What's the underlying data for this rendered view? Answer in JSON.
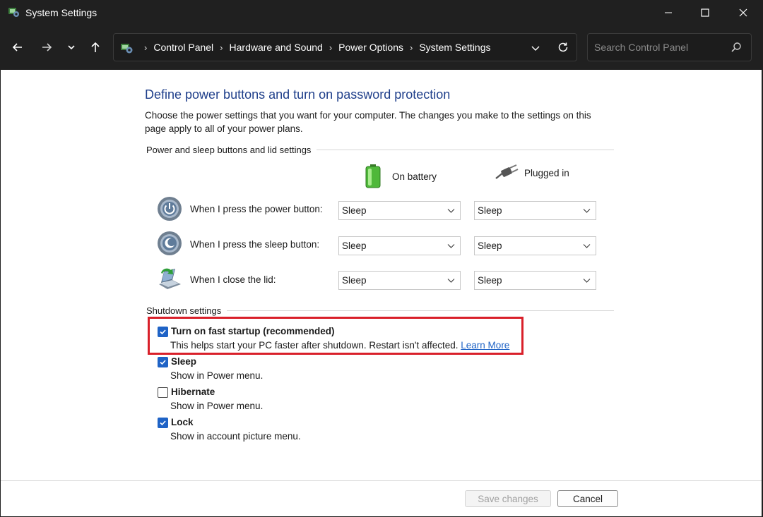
{
  "window": {
    "title": "System Settings"
  },
  "nav": {
    "breadcrumbs": [
      "Control Panel",
      "Hardware and Sound",
      "Power Options",
      "System Settings"
    ],
    "search_placeholder": "Search Control Panel"
  },
  "page": {
    "heading": "Define power buttons and turn on password protection",
    "description": "Choose the power settings that you want for your computer. The changes you make to the settings on this page apply to all of your power plans."
  },
  "buttons_section": {
    "label": "Power and sleep buttons and lid settings",
    "col_battery": "On battery",
    "col_plugged": "Plugged in",
    "rows": [
      {
        "label": "When I press the power button:",
        "battery": "Sleep",
        "plugged": "Sleep"
      },
      {
        "label": "When I press the sleep button:",
        "battery": "Sleep",
        "plugged": "Sleep"
      },
      {
        "label": "When I close the lid:",
        "battery": "Sleep",
        "plugged": "Sleep"
      }
    ]
  },
  "shutdown": {
    "label": "Shutdown settings",
    "options": [
      {
        "title": "Turn on fast startup (recommended)",
        "sub": "This helps start your PC faster after shutdown. Restart isn't affected.",
        "link": "Learn More",
        "checked": true
      },
      {
        "title": "Sleep",
        "sub": "Show in Power menu.",
        "checked": true
      },
      {
        "title": "Hibernate",
        "sub": "Show in Power menu.",
        "checked": false
      },
      {
        "title": "Lock",
        "sub": "Show in account picture menu.",
        "checked": true
      }
    ]
  },
  "footer": {
    "save_label": "Save changes",
    "cancel_label": "Cancel"
  },
  "colors": {
    "accent": "#1f63c6",
    "heading": "#1e3e8a",
    "highlight": "#d9202a",
    "chrome": "#202020"
  }
}
